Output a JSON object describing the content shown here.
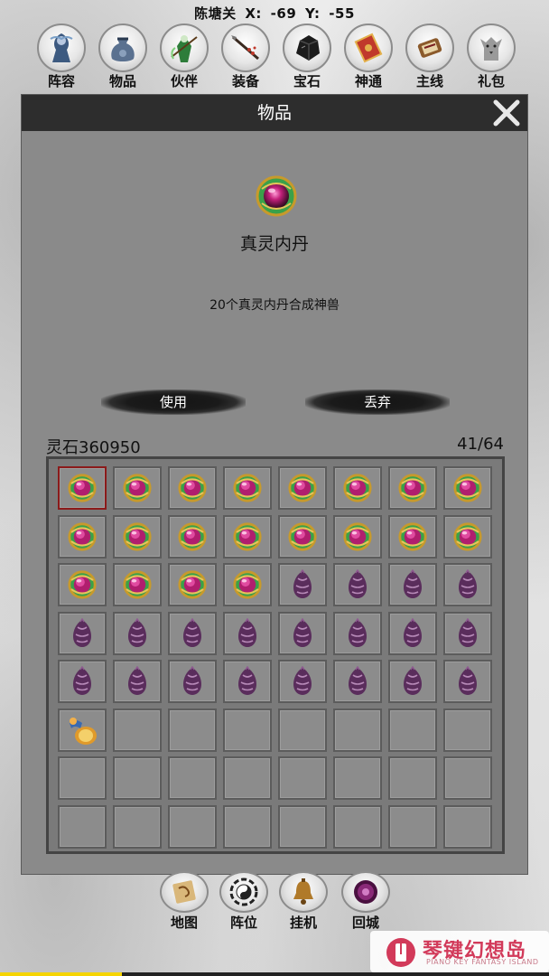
{
  "location": {
    "map_name": "陈塘关",
    "x_label": "X:",
    "x_value": "-69",
    "y_label": "Y:",
    "y_value": "-55"
  },
  "top_menu": [
    {
      "label": "阵容",
      "icon": "formation-hero-icon"
    },
    {
      "label": "物品",
      "icon": "item-bag-icon"
    },
    {
      "label": "伙伴",
      "icon": "companion-icon"
    },
    {
      "label": "装备",
      "icon": "equipment-spear-icon"
    },
    {
      "label": "宝石",
      "icon": "gem-ore-icon"
    },
    {
      "label": "神通",
      "icon": "skill-scroll-icon"
    },
    {
      "label": "主线",
      "icon": "quest-scroll-icon"
    },
    {
      "label": "礼包",
      "icon": "gift-wolf-icon"
    }
  ],
  "panel": {
    "title": "物品",
    "close_icon": "close-icon"
  },
  "selected_item": {
    "name": "真灵内丹",
    "description": "20个真灵内丹合成神兽",
    "icon": "spirit-core-orb-icon"
  },
  "actions": {
    "use_label": "使用",
    "discard_label": "丢弃"
  },
  "inventory": {
    "currency_label": "灵石360950",
    "capacity": "41/64",
    "columns": 8,
    "rows": 8,
    "selected_index": 0,
    "slots": [
      "spirit-core-orb",
      "spirit-core-orb",
      "spirit-core-orb",
      "spirit-core-orb",
      "spirit-core-orb",
      "spirit-core-orb",
      "spirit-core-orb",
      "spirit-core-orb",
      "spirit-core-orb",
      "spirit-core-orb",
      "spirit-core-orb",
      "spirit-core-orb",
      "spirit-core-orb",
      "spirit-core-orb",
      "spirit-core-orb",
      "spirit-core-orb",
      "spirit-core-orb",
      "spirit-core-orb",
      "spirit-core-orb",
      "spirit-core-orb",
      "purple-beast-egg",
      "purple-beast-egg",
      "purple-beast-egg",
      "purple-beast-egg",
      "purple-beast-egg",
      "purple-beast-egg",
      "purple-beast-egg",
      "purple-beast-egg",
      "purple-beast-egg",
      "purple-beast-egg",
      "purple-beast-egg",
      "purple-beast-egg",
      "purple-beast-egg",
      "purple-beast-egg",
      "purple-beast-egg",
      "purple-beast-egg",
      "purple-beast-egg",
      "purple-beast-egg",
      "purple-beast-egg",
      "purple-beast-egg",
      "gourd-drum",
      "",
      "",
      "",
      "",
      "",
      "",
      "",
      "",
      "",
      "",
      "",
      "",
      "",
      "",
      "",
      "",
      "",
      "",
      "",
      "",
      "",
      "",
      ""
    ]
  },
  "bottom_menu": [
    {
      "label": "地图",
      "icon": "map-scroll-icon"
    },
    {
      "label": "阵位",
      "icon": "bagua-icon"
    },
    {
      "label": "挂机",
      "icon": "bell-icon"
    },
    {
      "label": "回城",
      "icon": "portal-icon"
    }
  ],
  "watermark": {
    "title": "琴键幻想岛",
    "subtitle": "PIANO KEY FANTASY ISLAND"
  }
}
